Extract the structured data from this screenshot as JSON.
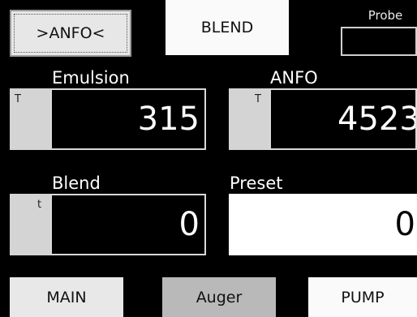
{
  "header": {
    "mode_anfo_label": ">ANFO<",
    "mode_blend_label": "BLEND",
    "probe_label": "Probe"
  },
  "fields": {
    "emulsion": {
      "label": "Emulsion",
      "key_label": "T",
      "value": "315"
    },
    "anfo": {
      "label": "ANFO",
      "key_label": "T",
      "value": "4523"
    },
    "blend": {
      "label": "Blend",
      "key_label": "t",
      "value": "0"
    },
    "preset": {
      "label": "Preset",
      "value": "0"
    }
  },
  "footer": {
    "main_label": "MAIN",
    "auger_label": "Auger",
    "pump_label": "PUMP"
  }
}
